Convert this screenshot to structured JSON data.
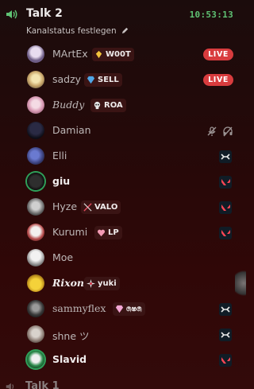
{
  "channel": {
    "name": "Talk 2",
    "time": "10:53:13",
    "status_label": "Kanalstatus festlegen"
  },
  "users": [
    {
      "name": "MArtEx",
      "tag": "W00T",
      "tag_icon": "diamond-icon",
      "badge": "LIVE",
      "bold": false
    },
    {
      "name": "sadzy",
      "tag": "SELL",
      "tag_icon": "gem-icon",
      "badge": "LIVE",
      "bold": false
    },
    {
      "name": "Buddy",
      "tag": "ROA",
      "tag_icon": "skull-icon",
      "bold": false
    },
    {
      "name": "Damian",
      "status": "muted-deafened",
      "bold": false
    },
    {
      "name": "Elli",
      "activity": "app-icon",
      "bold": false
    },
    {
      "name": "giu",
      "activity": "valorant-icon",
      "bold": true
    },
    {
      "name": "Hyze",
      "tag": "VALO",
      "tag_icon": "swords-icon",
      "activity": "valorant-icon",
      "bold": false
    },
    {
      "name": "Kurumi",
      "tag": "LP",
      "tag_icon": "heart-icon",
      "activity": "valorant-icon",
      "bold": false
    },
    {
      "name": "Moe",
      "bold": false
    },
    {
      "name": "Rixon",
      "tag": "yuki",
      "tag_icon": "sparkle-icon",
      "bold": true
    },
    {
      "name": "sammyflex",
      "tag": "෧ෂ෧",
      "tag_icon": "gem-icon",
      "activity": "app-icon",
      "bold": false
    },
    {
      "name": "shne ツ",
      "activity": "app-icon",
      "bold": false
    },
    {
      "name": "Slavid",
      "activity": "valorant-icon",
      "bold": true
    }
  ],
  "next_channel": {
    "name": "Talk 1"
  },
  "colors": {
    "live": "#d83c3e",
    "time": "#5fc274",
    "ring": "#2fa05a"
  }
}
